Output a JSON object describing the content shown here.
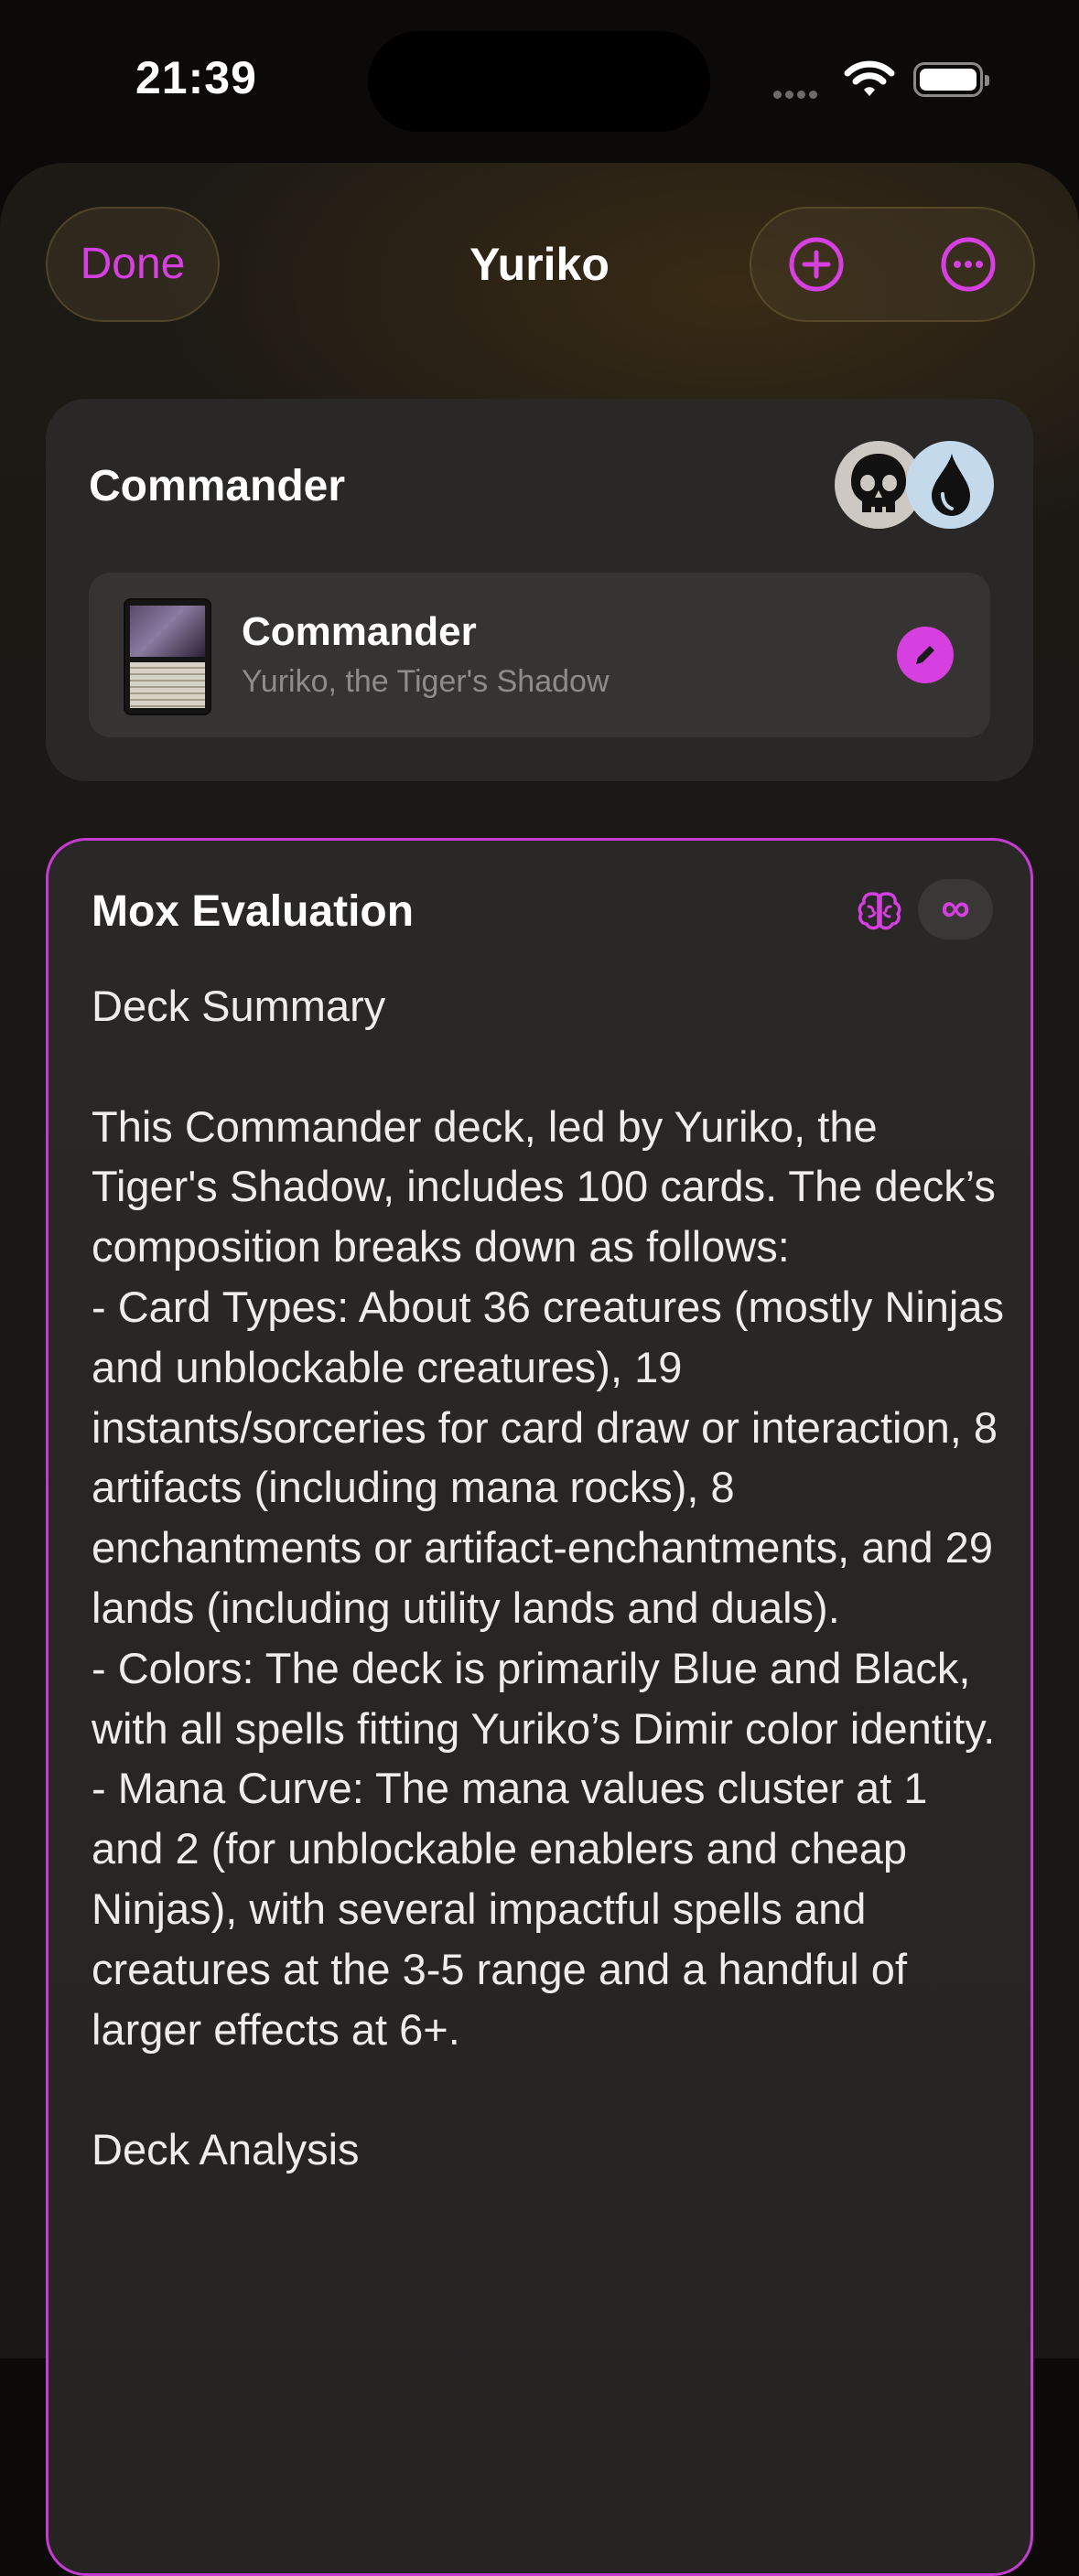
{
  "status_bar": {
    "time": "21:39"
  },
  "nav": {
    "done_label": "Done",
    "title": "Yuriko"
  },
  "commander_section": {
    "title": "Commander",
    "color_identity": [
      "black-mana-icon",
      "blue-mana-icon"
    ],
    "row": {
      "title": "Commander",
      "subtitle": "Yuriko, the Tiger's Shadow"
    }
  },
  "evaluation": {
    "title": "Mox Evaluation",
    "infinite_label": "∞",
    "text": "Deck Summary\n\nThis Commander deck, led by Yuriko, the Tiger's Shadow, includes 100 cards. The deck’s composition breaks down as follows:\n- Card Types: About 36 creatures (mostly Ninjas and unblockable creatures), 19 instants/sorceries for card draw or interaction, 8 artifacts (including mana rocks), 8 enchantments or artifact-enchantments, and 29 lands (including utility lands and duals).\n- Colors: The deck is primarily Blue and Black, with all spells fitting Yuriko’s Dimir color identity.\n- Mana Curve: The mana values cluster at 1 and 2 (for unblockable enablers and cheap Ninjas), with several impactful spells and creatures at the 3-5 range and a handful of larger effects at 6+.\n\nDeck Analysis"
  },
  "colors": {
    "accent": "#d63fe0",
    "card_bg": "#2a2826",
    "row_bg": "#363432"
  }
}
